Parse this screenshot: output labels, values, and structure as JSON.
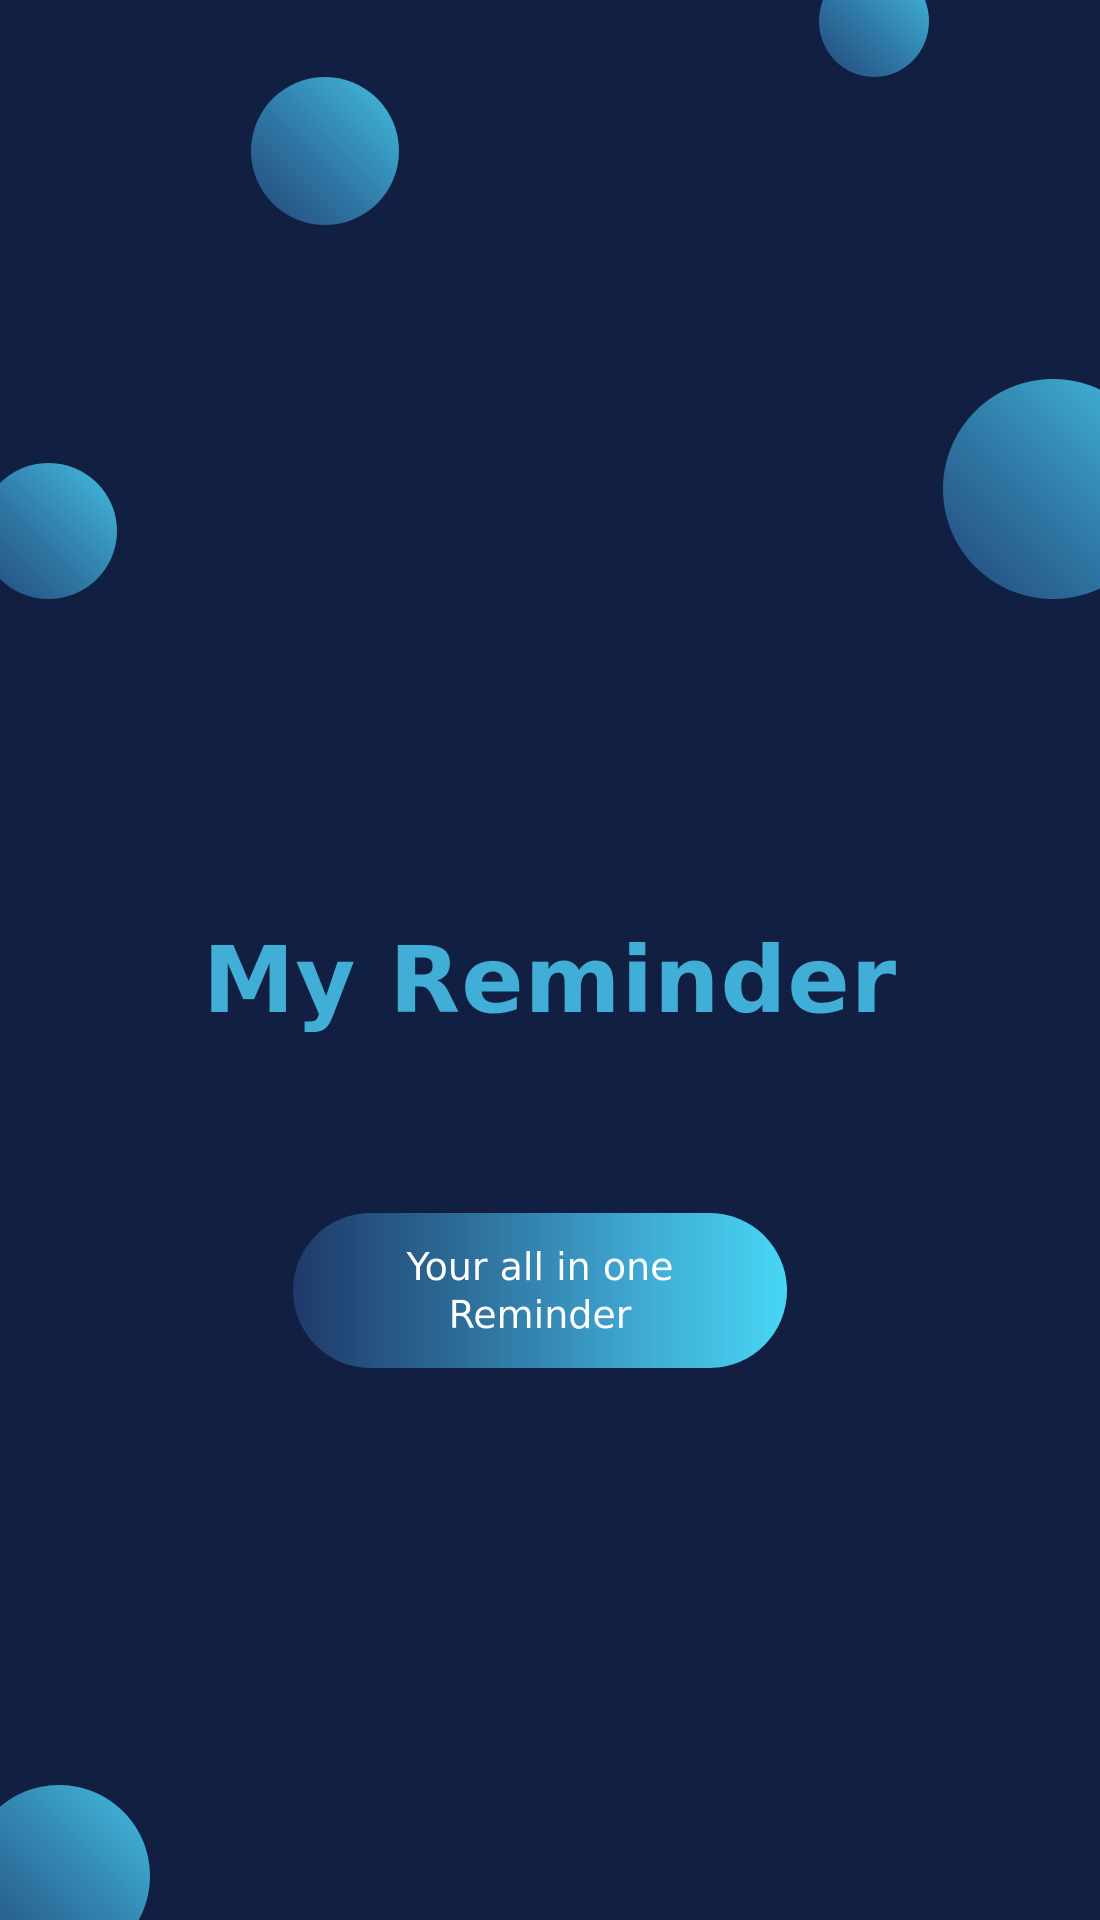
{
  "app": {
    "title": "My Reminder",
    "tagline": "Your all in one Reminder"
  },
  "colors": {
    "background": "#112042",
    "title": "#40aed6",
    "tagline_text": "#ffffff",
    "accent_light": "#48d6f5",
    "accent_dark": "#1f3a6a"
  }
}
